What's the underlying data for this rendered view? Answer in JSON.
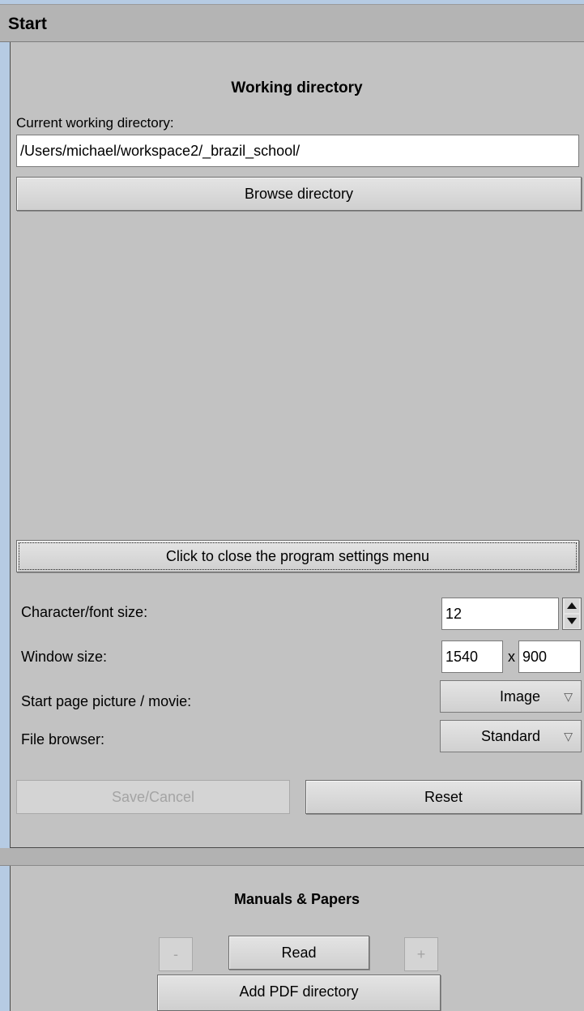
{
  "window": {
    "title": "Start"
  },
  "working_directory": {
    "heading": "Working directory",
    "current_label": "Current working directory:",
    "path_value": "/Users/michael/workspace2/_brazil_school/",
    "browse_button": "Browse directory"
  },
  "settings": {
    "close_button": "Click to close the program settings menu",
    "font_size_label": "Character/font size:",
    "font_size_value": "12",
    "window_size_label": "Window size:",
    "window_width": "1540",
    "window_height": "900",
    "size_separator": "x",
    "start_page_label": "Start page picture / movie:",
    "start_page_value": "Image",
    "file_browser_label": "File browser:",
    "file_browser_value": "Standard",
    "dropdown_arrow": "▽",
    "save_cancel_button": "Save/Cancel",
    "reset_button": "Reset"
  },
  "manuals": {
    "heading": "Manuals & Papers",
    "minus_button": "-",
    "read_button": "Read",
    "plus_button": "+",
    "add_pdf_button": "Add PDF directory"
  }
}
